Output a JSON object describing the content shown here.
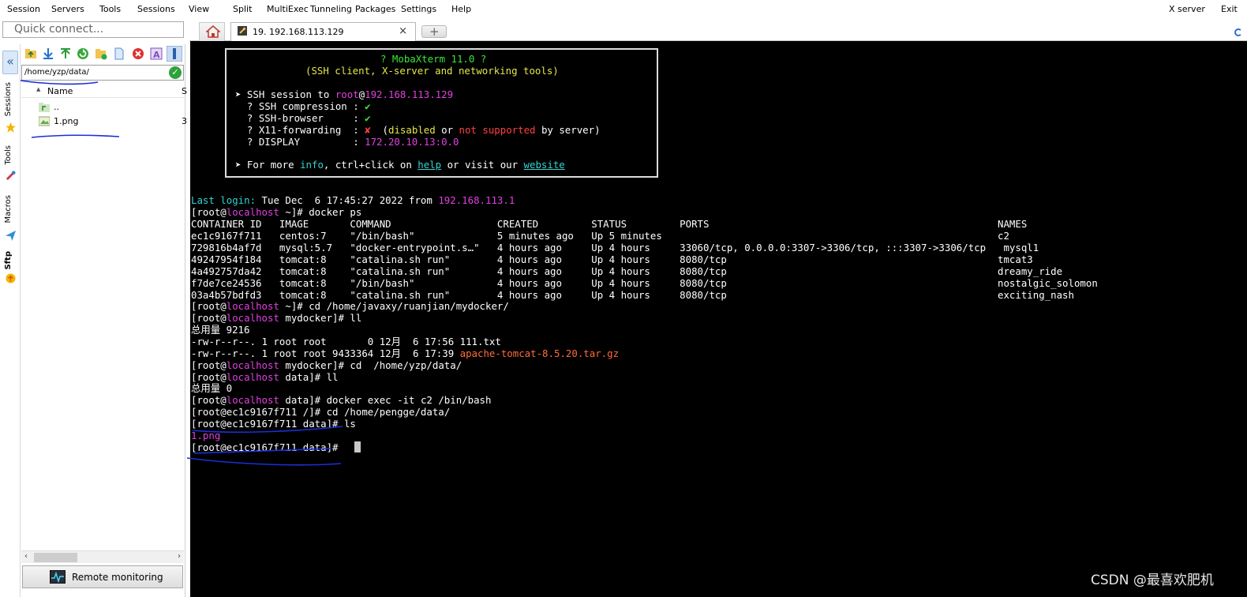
{
  "menu": {
    "items": [
      "Session",
      "Servers",
      "Tools",
      "Sessions",
      "View",
      "Split",
      "MultiExec",
      "Tunneling",
      "Packages",
      "Settings",
      "Help"
    ],
    "right_items": [
      "X server",
      "Exit"
    ]
  },
  "quick_connect": {
    "placeholder": "Quick connect..."
  },
  "tabs": {
    "home_icon": "home-icon",
    "session_tab": {
      "label": "19. 192.168.113.129",
      "icon": "wrench-icon"
    },
    "new_tab_icon": "plus-icon"
  },
  "sidebar": {
    "labels": [
      "Sessions",
      "Tools",
      "Macros",
      "Sftp"
    ]
  },
  "sftp": {
    "path": "/home/yzp/data/",
    "columns": {
      "name": "Name",
      "size": "S"
    },
    "files": [
      {
        "name": "..",
        "icon": "folder-up-icon"
      },
      {
        "name": "1.png",
        "icon": "image-file-icon",
        "size": "3"
      }
    ],
    "remote_monitoring": "Remote monitoring"
  },
  "terminal": {
    "banner": {
      "title": "? MobaXterm 11.0 ?",
      "subtitle": "(SSH client, X-server and networking tools)",
      "ssh_session_prefix": "➤ SSH session to ",
      "ssh_user": "root",
      "ssh_at": "@",
      "ssh_host": "192.168.113.129",
      "compression_label": "  ? SSH compression : ",
      "browser_label": "  ? SSH-browser     : ",
      "x11_label": "  ? X11-forwarding  : ",
      "check": "✔",
      "cross": "✘",
      "x11_open": "  (",
      "x11_disabled": "disabled",
      "x11_or": " or ",
      "x11_notsupported": "not supported",
      "x11_tail": " by server)",
      "display_label": "  ? DISPLAY         : ",
      "display_value": "172.20.10.13:0.0",
      "more_prefix": "➤ For more ",
      "more_info": "info",
      "more_mid": ", ctrl+click on ",
      "more_help": "help",
      "more_mid2": " or visit our ",
      "more_website": "website"
    },
    "last_login_label": "Last login:",
    "last_login_text": " Tue Dec  6 17:45:27 2022 from ",
    "last_login_ip": "192.168.113.1",
    "prompt_open": "[root@",
    "prompt_host": "localhost",
    "lines": {
      "p1_tail": " ~]# docker ps",
      "ps_header": "CONTAINER ID   IMAGE       COMMAND                  CREATED         STATUS         PORTS                                                 NAMES",
      "ps_rows": [
        "ec1c9167f711   centos:7    \"/bin/bash\"              5 minutes ago   Up 5 minutes                                                         c2",
        "729816b4af7d   mysql:5.7   \"docker-entrypoint.s…\"   4 hours ago     Up 4 hours     33060/tcp, 0.0.0.0:3307->3306/tcp, :::3307->3306/tcp   mysql1",
        "49247954f184   tomcat:8    \"catalina.sh run\"        4 hours ago     Up 4 hours     8080/tcp                                              tmcat3",
        "4a492757da42   tomcat:8    \"catalina.sh run\"        4 hours ago     Up 4 hours     8080/tcp                                              dreamy_ride",
        "f7de7ce24536   tomcat:8    \"/bin/bash\"              4 hours ago     Up 4 hours     8080/tcp                                              nostalgic_solomon",
        "03a4b57bdfd3   tomcat:8    \"catalina.sh run\"        4 hours ago     Up 4 hours     8080/tcp                                              exciting_nash"
      ],
      "p2_tail": " ~]# cd /home/javaxy/ruanjian/mydocker/",
      "p3_tail": " mydocker]# ll",
      "total1": "总用量 9216",
      "ls1": "-rw-r--r--. 1 root root       0 12月  6 17:56 111.txt",
      "ls2_prefix": "-rw-r--r--. 1 root root 9433364 12月  6 17:39 ",
      "ls2_file": "apache-tomcat-8.5.20.tar.gz",
      "p4_tail": " mydocker]# cd  /home/yzp/data/",
      "p5_tail": " data]# ll",
      "total2": "总用量 0",
      "p6_tail": " data]# docker exec -it c2 /bin/bash",
      "c1": "[root@ec1c9167f711 /]# cd /home/pengge/data/",
      "c2": "[root@ec1c9167f711 data]# ls",
      "c3": "1.png",
      "c4": "[root@ec1c9167f711 data]# "
    }
  },
  "watermark": "CSDN @最喜欢肥机",
  "colors": {
    "magenta": "#e040e0",
    "cyan": "#32d4d4",
    "yellow": "#e6e64a",
    "green": "#39e639",
    "red": "#ff4040",
    "orange": "#ff6b3a",
    "annotation_ink": "#1a2fd8"
  }
}
